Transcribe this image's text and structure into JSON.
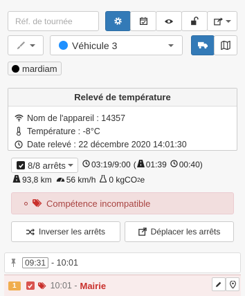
{
  "toolbar": {
    "tour_ref_placeholder": "Réf. de tournée"
  },
  "vehicle": {
    "name": "Véhicule 3",
    "color": "#1e90ff"
  },
  "user_tag": {
    "name": "mardiam",
    "color": "#000000"
  },
  "temperature_panel": {
    "title": "Relevé de température",
    "device_label": "Nom de l'appareil : 14357",
    "temperature_label": "Température : -8°C",
    "date_label": "Date relevé : 22 décembre 2020 14:01:30"
  },
  "summary": {
    "stops_label": "8/8 arrêts",
    "duration": "03:19/9:00",
    "paren_open": "(",
    "drive_time": "01:39",
    "wait_time": "00:40)",
    "distance": "93,8 km",
    "speed": "56 km/h",
    "co2_value": "0 kgCO",
    "co2_sub": "2",
    "co2_suffix": "e"
  },
  "alert": {
    "text": "Compétence incompatible"
  },
  "actions": {
    "reverse_label": "Inverser les arrêts",
    "move_label": "Déplacer les arrêts"
  },
  "timeline": {
    "start_time": "09:31",
    "end_time": "- 10:01"
  },
  "stop": {
    "index": "1",
    "time": "10:01 -",
    "name": "Mairie"
  },
  "colors": {
    "primary": "#337ab7",
    "danger": "#a94442",
    "warning": "#f0ad4e"
  }
}
